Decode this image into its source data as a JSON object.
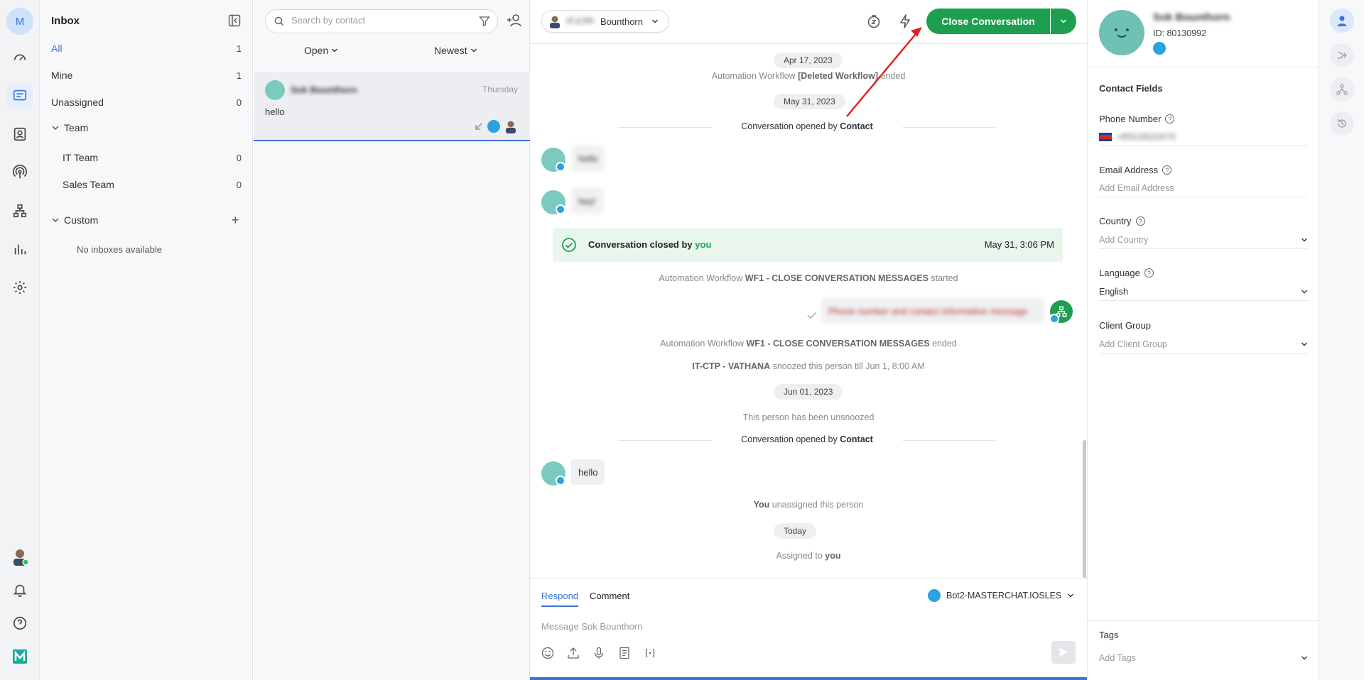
{
  "rail": {
    "avatar_initial": "M",
    "icons": [
      "dashboard-icon",
      "chat-icon",
      "contacts-icon",
      "broadcast-icon",
      "workflow-icon",
      "reports-icon",
      "settings-icon"
    ],
    "bottom_icons": [
      "user-avatar",
      "bell-icon",
      "help-icon",
      "logo-icon"
    ]
  },
  "inbox": {
    "title": "Inbox",
    "items": [
      {
        "label": "All",
        "count": "1"
      },
      {
        "label": "Mine",
        "count": "1"
      },
      {
        "label": "Unassigned",
        "count": "0"
      }
    ],
    "team_label": "Team",
    "teams": [
      {
        "label": "IT Team",
        "count": "0"
      },
      {
        "label": "Sales Team",
        "count": "0"
      }
    ],
    "custom_label": "Custom",
    "no_inboxes": "No inboxes available"
  },
  "convlist": {
    "search_placeholder": "Search by contact",
    "status_filter": "Open",
    "sort_filter": "Newest",
    "conversation": {
      "name": "Sok Bounthorn",
      "time": "Thursday",
      "preview": "hello"
    }
  },
  "chat": {
    "assignee_name": "Bounthorn",
    "assignee_prefix": "IT-CTP-",
    "close_button": "Close Conversation",
    "messages": {
      "date1": "Apr 17, 2023",
      "wf1_prefix": "Automation Workflow",
      "wf1_name": "[Deleted Workflow]",
      "wf1_suffix": "ended",
      "date2": "May 31, 2023",
      "opened_prefix": "Conversation opened by",
      "opened_by": "Contact",
      "bubble1": "hello",
      "bubble2": "hey!",
      "closed_prefix": "Conversation closed by",
      "closed_by": "you",
      "closed_time": "May 31, 3:06 PM",
      "wf2_prefix": "Automation Workflow",
      "wf2_name": "WF1 - CLOSE CONVERSATION MESSAGES",
      "wf2_started": "started",
      "outgoing_blurred": "Phone number and contact information message",
      "wf2_ended": "ended",
      "snooze_actor": "IT-CTP - VATHANA",
      "snooze_text": "snoozed this person till Jun 1, 8:00 AM",
      "date3": "Jun 01, 2023",
      "unsnoozed": "This person has been unsnoozed",
      "opened2_prefix": "Conversation opened by",
      "opened2_by": "Contact",
      "bubble3": "hello",
      "unassign_actor": "You",
      "unassign_text": "unassigned this person",
      "date4": "Today",
      "assigned_prefix": "Assigned to",
      "assigned_to": "you"
    },
    "reply": {
      "tab_respond": "Respond",
      "tab_comment": "Comment",
      "channel": "Bot2-MASTERCHAT.IOSLES",
      "placeholder": "Message Sok Bounthorn"
    }
  },
  "contact": {
    "name": "Sok Bounthorn",
    "id_text": "ID: 80130992",
    "section_title": "Contact Fields",
    "phone_label": "Phone Number",
    "phone_value": "+85516522070",
    "email_label": "Email Address",
    "email_placeholder": "Add Email Address",
    "country_label": "Country",
    "country_placeholder": "Add Country",
    "language_label": "Language",
    "language_value": "English",
    "client_group_label": "Client Group",
    "client_group_placeholder": "Add Client Group",
    "tags_label": "Tags",
    "tags_placeholder": "Add Tags"
  },
  "colors": {
    "accent": "#3b73d9",
    "success": "#1e9e4f",
    "telegram": "#2aa3df",
    "avatar": "#7cc9bf"
  }
}
